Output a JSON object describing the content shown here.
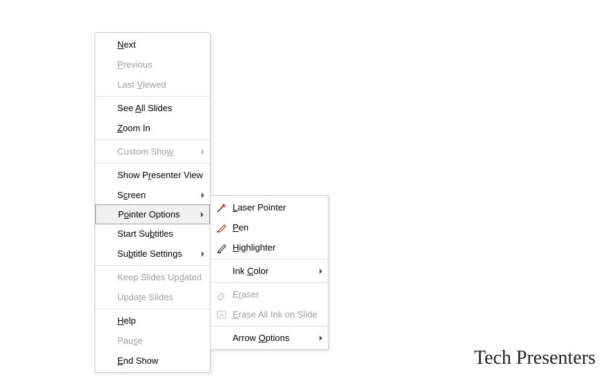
{
  "mainMenu": {
    "next": "Next",
    "previous": "Previous",
    "lastViewed": "Last Viewed",
    "seeAllSlides": "See All Slides",
    "zoomIn": "Zoom In",
    "customShow": "Custom Show",
    "showPresenterView": "Show Presenter View",
    "screen": "Screen",
    "pointerOptions": "Pointer Options",
    "startSubtitles": "Start Subtitles",
    "subtitleSettings": "Subtitle Settings",
    "keepSlidesUpdated": "Keep Slides Updated",
    "updateSlides": "Update Slides",
    "help": "Help",
    "pause": "Pause",
    "endShow": "End Show"
  },
  "subMenu": {
    "laserPointer": "Laser Pointer",
    "pen": "Pen",
    "highlighter": "Highlighter",
    "inkColor": "Ink Color",
    "eraser": "Eraser",
    "eraseAllInk": "Erase All Ink on Slide",
    "arrowOptions": "Arrow Options"
  },
  "watermark": "Tech Presenters"
}
